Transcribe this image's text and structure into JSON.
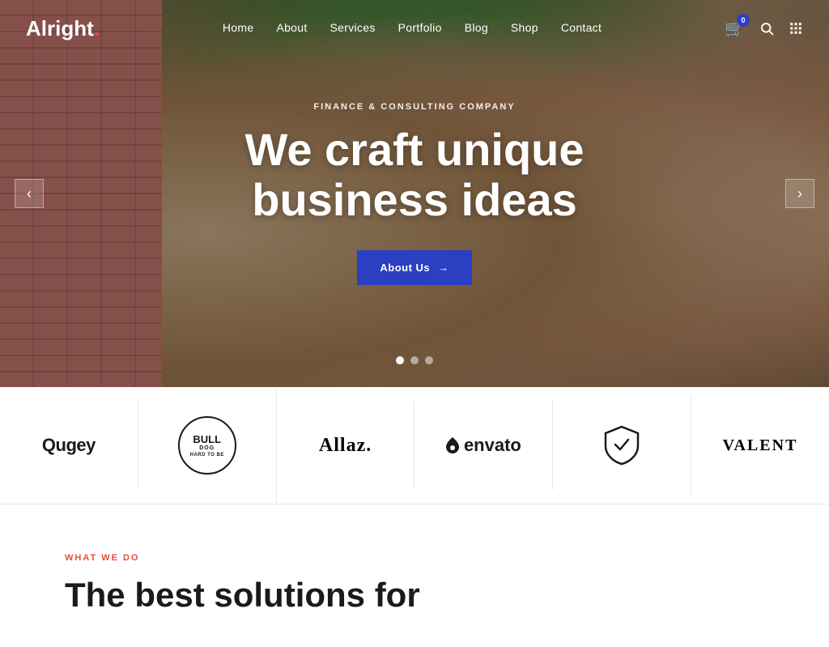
{
  "header": {
    "logo": "Alright",
    "logo_dot": ".",
    "nav": [
      {
        "label": "Home",
        "href": "#"
      },
      {
        "label": "About",
        "href": "#"
      },
      {
        "label": "Services",
        "href": "#"
      },
      {
        "label": "Portfolio",
        "href": "#"
      },
      {
        "label": "Blog",
        "href": "#"
      },
      {
        "label": "Shop",
        "href": "#"
      },
      {
        "label": "Contact",
        "href": "#"
      }
    ],
    "cart_count": "0"
  },
  "hero": {
    "subtitle": "Finance & Consulting Company",
    "title_line1": "We craft unique",
    "title_line2": "business ideas",
    "cta_label": "About Us",
    "cta_arrow": "→",
    "prev_icon": "‹",
    "next_icon": "›",
    "dots": [
      {
        "active": true
      },
      {
        "active": false
      },
      {
        "active": false
      }
    ]
  },
  "logos": [
    {
      "type": "text",
      "text": "Qugey"
    },
    {
      "type": "circle",
      "big": "BULLDOG",
      "small": "HARD TO BE"
    },
    {
      "type": "allaz",
      "text": "Allaz"
    },
    {
      "type": "envato",
      "text": "envato"
    },
    {
      "type": "shield",
      "text": "🛡"
    },
    {
      "type": "valent",
      "text": "VALENT"
    }
  ],
  "below": {
    "tag": "What We Do",
    "title_line1": "The best solutions for"
  },
  "icons": {
    "cart": "🛒",
    "search": "🔍",
    "grid": "⋮⋮"
  }
}
